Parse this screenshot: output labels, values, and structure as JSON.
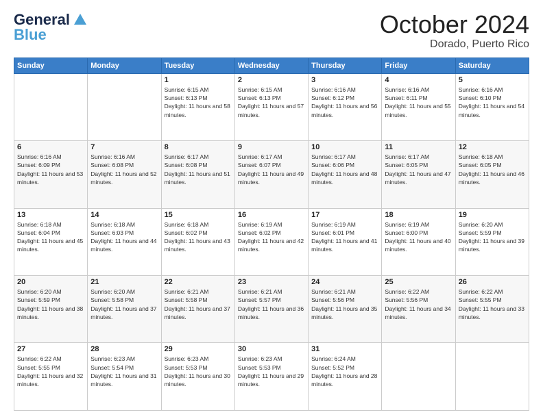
{
  "logo": {
    "name_part1": "General",
    "name_part2": "Blue"
  },
  "title": "October 2024",
  "subtitle": "Dorado, Puerto Rico",
  "days_of_week": [
    "Sunday",
    "Monday",
    "Tuesday",
    "Wednesday",
    "Thursday",
    "Friday",
    "Saturday"
  ],
  "weeks": [
    [
      {
        "day": null,
        "sunrise": null,
        "sunset": null,
        "daylight": null
      },
      {
        "day": null,
        "sunrise": null,
        "sunset": null,
        "daylight": null
      },
      {
        "day": "1",
        "sunrise": "Sunrise: 6:15 AM",
        "sunset": "Sunset: 6:13 PM",
        "daylight": "Daylight: 11 hours and 58 minutes."
      },
      {
        "day": "2",
        "sunrise": "Sunrise: 6:15 AM",
        "sunset": "Sunset: 6:13 PM",
        "daylight": "Daylight: 11 hours and 57 minutes."
      },
      {
        "day": "3",
        "sunrise": "Sunrise: 6:16 AM",
        "sunset": "Sunset: 6:12 PM",
        "daylight": "Daylight: 11 hours and 56 minutes."
      },
      {
        "day": "4",
        "sunrise": "Sunrise: 6:16 AM",
        "sunset": "Sunset: 6:11 PM",
        "daylight": "Daylight: 11 hours and 55 minutes."
      },
      {
        "day": "5",
        "sunrise": "Sunrise: 6:16 AM",
        "sunset": "Sunset: 6:10 PM",
        "daylight": "Daylight: 11 hours and 54 minutes."
      }
    ],
    [
      {
        "day": "6",
        "sunrise": "Sunrise: 6:16 AM",
        "sunset": "Sunset: 6:09 PM",
        "daylight": "Daylight: 11 hours and 53 minutes."
      },
      {
        "day": "7",
        "sunrise": "Sunrise: 6:16 AM",
        "sunset": "Sunset: 6:08 PM",
        "daylight": "Daylight: 11 hours and 52 minutes."
      },
      {
        "day": "8",
        "sunrise": "Sunrise: 6:17 AM",
        "sunset": "Sunset: 6:08 PM",
        "daylight": "Daylight: 11 hours and 51 minutes."
      },
      {
        "day": "9",
        "sunrise": "Sunrise: 6:17 AM",
        "sunset": "Sunset: 6:07 PM",
        "daylight": "Daylight: 11 hours and 49 minutes."
      },
      {
        "day": "10",
        "sunrise": "Sunrise: 6:17 AM",
        "sunset": "Sunset: 6:06 PM",
        "daylight": "Daylight: 11 hours and 48 minutes."
      },
      {
        "day": "11",
        "sunrise": "Sunrise: 6:17 AM",
        "sunset": "Sunset: 6:05 PM",
        "daylight": "Daylight: 11 hours and 47 minutes."
      },
      {
        "day": "12",
        "sunrise": "Sunrise: 6:18 AM",
        "sunset": "Sunset: 6:05 PM",
        "daylight": "Daylight: 11 hours and 46 minutes."
      }
    ],
    [
      {
        "day": "13",
        "sunrise": "Sunrise: 6:18 AM",
        "sunset": "Sunset: 6:04 PM",
        "daylight": "Daylight: 11 hours and 45 minutes."
      },
      {
        "day": "14",
        "sunrise": "Sunrise: 6:18 AM",
        "sunset": "Sunset: 6:03 PM",
        "daylight": "Daylight: 11 hours and 44 minutes."
      },
      {
        "day": "15",
        "sunrise": "Sunrise: 6:18 AM",
        "sunset": "Sunset: 6:02 PM",
        "daylight": "Daylight: 11 hours and 43 minutes."
      },
      {
        "day": "16",
        "sunrise": "Sunrise: 6:19 AM",
        "sunset": "Sunset: 6:02 PM",
        "daylight": "Daylight: 11 hours and 42 minutes."
      },
      {
        "day": "17",
        "sunrise": "Sunrise: 6:19 AM",
        "sunset": "Sunset: 6:01 PM",
        "daylight": "Daylight: 11 hours and 41 minutes."
      },
      {
        "day": "18",
        "sunrise": "Sunrise: 6:19 AM",
        "sunset": "Sunset: 6:00 PM",
        "daylight": "Daylight: 11 hours and 40 minutes."
      },
      {
        "day": "19",
        "sunrise": "Sunrise: 6:20 AM",
        "sunset": "Sunset: 5:59 PM",
        "daylight": "Daylight: 11 hours and 39 minutes."
      }
    ],
    [
      {
        "day": "20",
        "sunrise": "Sunrise: 6:20 AM",
        "sunset": "Sunset: 5:59 PM",
        "daylight": "Daylight: 11 hours and 38 minutes."
      },
      {
        "day": "21",
        "sunrise": "Sunrise: 6:20 AM",
        "sunset": "Sunset: 5:58 PM",
        "daylight": "Daylight: 11 hours and 37 minutes."
      },
      {
        "day": "22",
        "sunrise": "Sunrise: 6:21 AM",
        "sunset": "Sunset: 5:58 PM",
        "daylight": "Daylight: 11 hours and 37 minutes."
      },
      {
        "day": "23",
        "sunrise": "Sunrise: 6:21 AM",
        "sunset": "Sunset: 5:57 PM",
        "daylight": "Daylight: 11 hours and 36 minutes."
      },
      {
        "day": "24",
        "sunrise": "Sunrise: 6:21 AM",
        "sunset": "Sunset: 5:56 PM",
        "daylight": "Daylight: 11 hours and 35 minutes."
      },
      {
        "day": "25",
        "sunrise": "Sunrise: 6:22 AM",
        "sunset": "Sunset: 5:56 PM",
        "daylight": "Daylight: 11 hours and 34 minutes."
      },
      {
        "day": "26",
        "sunrise": "Sunrise: 6:22 AM",
        "sunset": "Sunset: 5:55 PM",
        "daylight": "Daylight: 11 hours and 33 minutes."
      }
    ],
    [
      {
        "day": "27",
        "sunrise": "Sunrise: 6:22 AM",
        "sunset": "Sunset: 5:55 PM",
        "daylight": "Daylight: 11 hours and 32 minutes."
      },
      {
        "day": "28",
        "sunrise": "Sunrise: 6:23 AM",
        "sunset": "Sunset: 5:54 PM",
        "daylight": "Daylight: 11 hours and 31 minutes."
      },
      {
        "day": "29",
        "sunrise": "Sunrise: 6:23 AM",
        "sunset": "Sunset: 5:53 PM",
        "daylight": "Daylight: 11 hours and 30 minutes."
      },
      {
        "day": "30",
        "sunrise": "Sunrise: 6:23 AM",
        "sunset": "Sunset: 5:53 PM",
        "daylight": "Daylight: 11 hours and 29 minutes."
      },
      {
        "day": "31",
        "sunrise": "Sunrise: 6:24 AM",
        "sunset": "Sunset: 5:52 PM",
        "daylight": "Daylight: 11 hours and 28 minutes."
      },
      {
        "day": null,
        "sunrise": null,
        "sunset": null,
        "daylight": null
      },
      {
        "day": null,
        "sunrise": null,
        "sunset": null,
        "daylight": null
      }
    ]
  ]
}
